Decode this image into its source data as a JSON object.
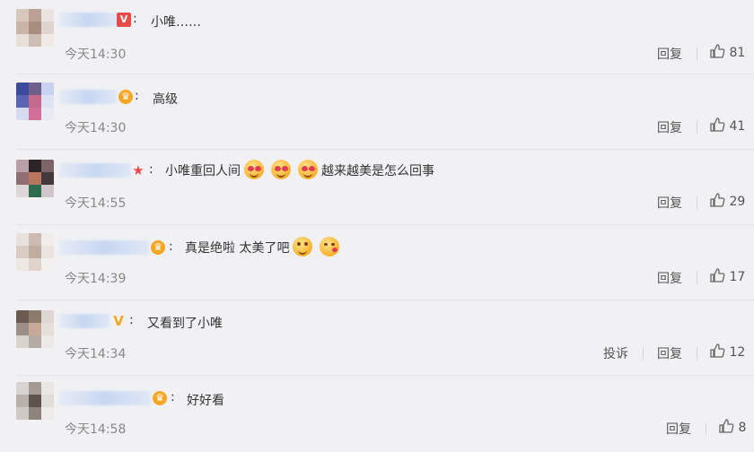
{
  "colors": {
    "background": "#f1f1f4",
    "text": "#333333",
    "muted": "#888888",
    "badge_gold": "#f5a623",
    "badge_red": "#e94a4a"
  },
  "comments": [
    {
      "text": "小唯……",
      "time": "今天14:30",
      "reply_label": "回复",
      "likes": "81",
      "badge": "v-badge"
    },
    {
      "text": "高级",
      "time": "今天14:30",
      "reply_label": "回复",
      "likes": "41",
      "badge": "crown-badge"
    },
    {
      "text_before": "小唯重回人间",
      "text_after": "越来越美是怎么回事",
      "time": "今天14:55",
      "reply_label": "回复",
      "likes": "29",
      "badge": "star-badge",
      "emojis": [
        "heart-eyes-emoji",
        "heart-eyes-emoji",
        "heart-eyes-emoji"
      ]
    },
    {
      "text": "真是绝啦 太美了吧",
      "time": "今天14:39",
      "reply_label": "回复",
      "likes": "17",
      "badge": "crown-badge",
      "emojis": [
        "hug-emoji",
        "kiss-emoji"
      ]
    },
    {
      "text": "又看到了小唯",
      "time": "今天14:34",
      "report_label": "投诉",
      "reply_label": "回复",
      "likes": "12",
      "badge": "v-badge"
    },
    {
      "text": "好好看",
      "time": "今天14:58",
      "reply_label": "回复",
      "likes": "8",
      "badge": "crown-badge"
    }
  ]
}
